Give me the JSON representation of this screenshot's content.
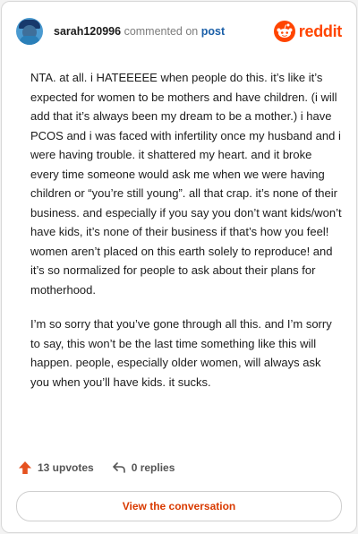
{
  "header": {
    "username": "sarah120996",
    "action_text": "commented on",
    "post_link": "post",
    "brand": "reddit"
  },
  "comment": {
    "paragraphs": [
      "NTA. at all. i HATEEEEE when people do this. it’s like it’s expected for women to be mothers and have children. (i will add that it’s always been my dream to be a mother.) i have PCOS and i was faced with infertility once my husband and i were having trouble. it shattered my heart. and it broke every time someone would ask me when we were having children or “you’re still young”. all that crap. it’s none of their business. and especially if you say you don’t want kids/won’t have kids, it’s none of their business if that’s how you feel! women aren’t placed on this earth solely to reproduce! and it’s so normalized for people to ask about their plans for motherhood.",
      "I’m so sorry that you’ve gone through all this. and I’m sorry to say, this won’t be the last time something like this will happen. people, especially older women, will always ask you when you’ll have kids. it sucks."
    ]
  },
  "actions": {
    "upvotes": "13 upvotes",
    "replies": "0 replies"
  },
  "footer": {
    "view_button": "View the conversation"
  },
  "icons": {
    "upvote": "upvote-arrow-icon",
    "reply": "reply-arrow-icon",
    "brand": "reddit-snoo-icon",
    "avatar": "user-avatar"
  },
  "colors": {
    "brand": "#ff4500",
    "link": "#1a5fa8",
    "button_text": "#d93a00"
  }
}
